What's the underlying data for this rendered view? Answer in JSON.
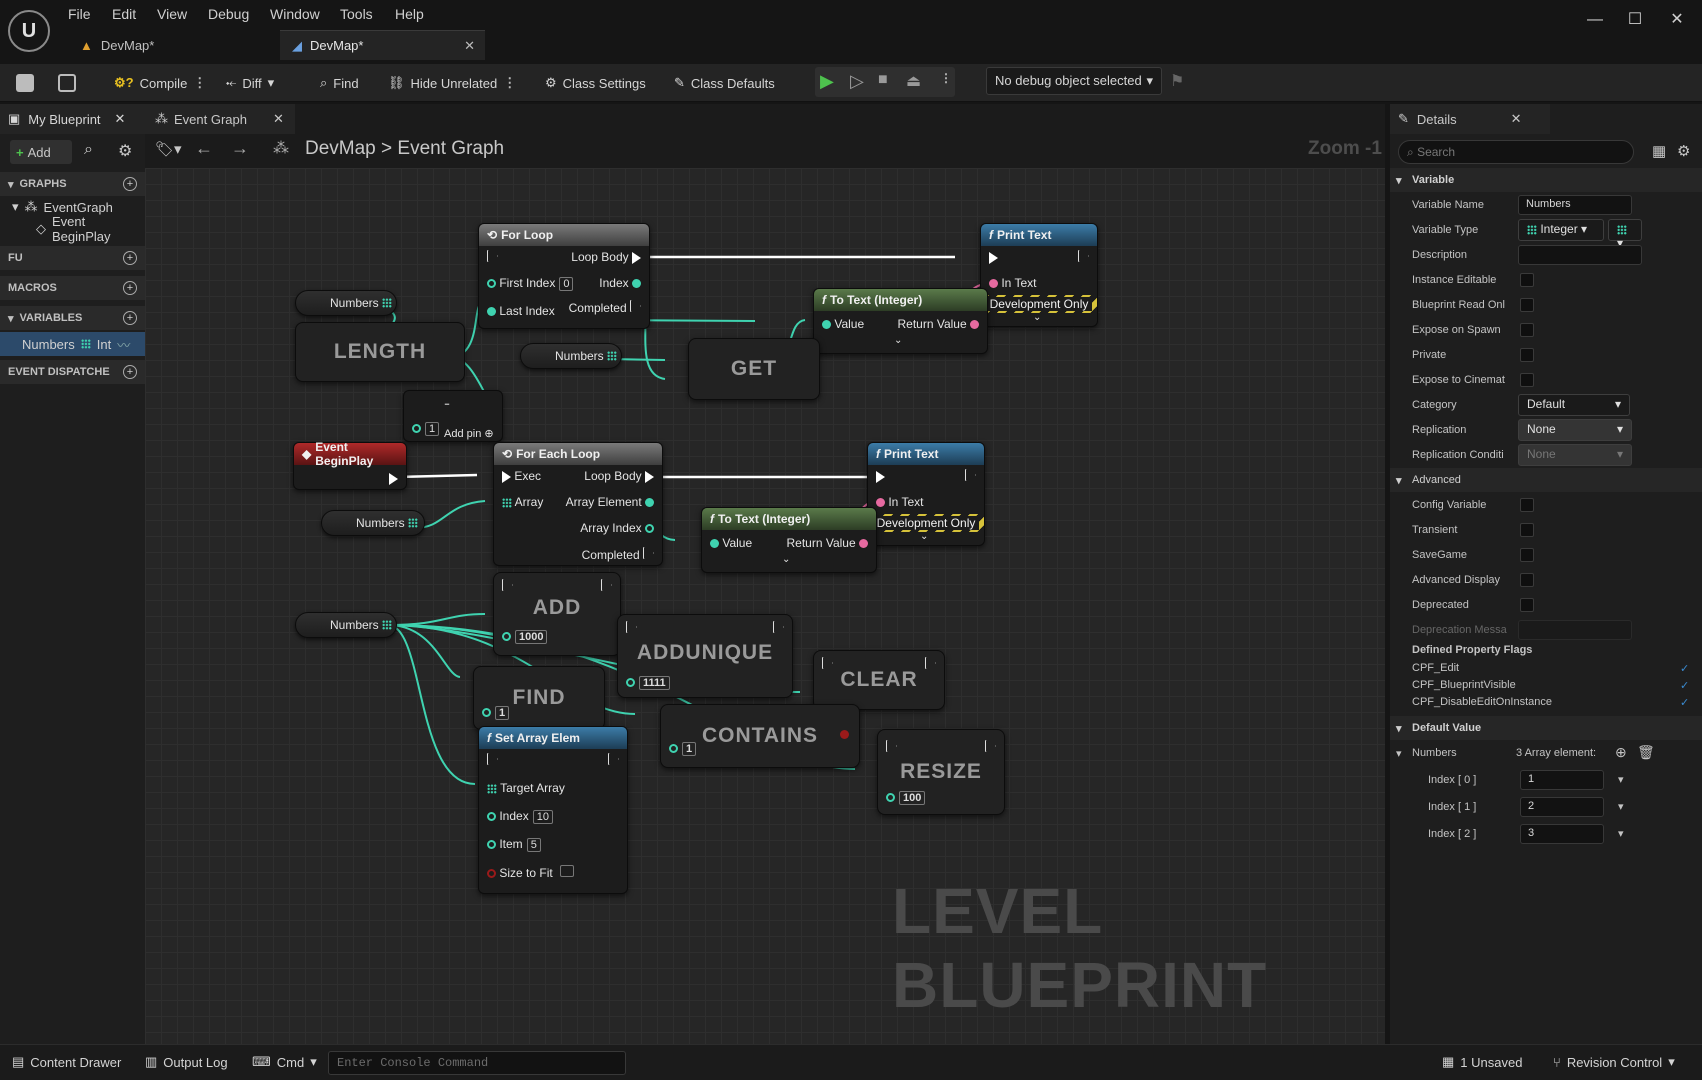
{
  "menu": [
    "File",
    "Edit",
    "View",
    "Debug",
    "Window",
    "Tools",
    "Help"
  ],
  "tabs": [
    {
      "label": "DevMap*"
    },
    {
      "label": "DevMap*"
    }
  ],
  "toolbar": {
    "compile": "Compile",
    "diff": "Diff",
    "find": "Find",
    "hide_unrelated": "Hide Unrelated",
    "class_settings": "Class Settings",
    "class_defaults": "Class Defaults",
    "debug_object": "No debug object selected"
  },
  "left_panel": {
    "tab_my_blueprint": "My Blueprint",
    "tab_event_graph": "Event Graph",
    "add": "Add",
    "graphs": "GRAPHS",
    "eventgraph": "EventGraph",
    "event_begin_play": "Event BeginPlay",
    "functions": "FU",
    "macros": "MACROS",
    "variables": "VARIABLES",
    "var_name": "Numbers",
    "var_type": "Int",
    "event_dispatchers": "EVENT DISPATCHE"
  },
  "graph": {
    "breadcrumb_root": "DevMap",
    "breadcrumb_sep": ">",
    "breadcrumb_leaf": "Event Graph",
    "zoom": "Zoom -1",
    "watermark": "LEVEL BLUEPRINT",
    "for_loop": {
      "title": "For Loop",
      "loop_body": "Loop Body",
      "first_index": "First Index",
      "first_index_val": "0",
      "index": "Index",
      "last_index": "Last Index",
      "completed": "Completed"
    },
    "print_text_1": {
      "title": "Print Text",
      "in_text": "In Text",
      "dev_only": "Development Only"
    },
    "to_text_1": {
      "title": "To Text (Integer)",
      "value": "Value",
      "return_value": "Return Value"
    },
    "numbers_label": "Numbers",
    "length": "LENGTH",
    "get": "GET",
    "minus": "-",
    "minus_val": "1",
    "add_pin": "Add pin",
    "event_begin_play": "Event BeginPlay",
    "for_each": {
      "title": "For Each Loop",
      "exec": "Exec",
      "loop_body": "Loop Body",
      "array": "Array",
      "array_element": "Array Element",
      "array_index": "Array Index",
      "completed": "Completed"
    },
    "print_text_2": {
      "title": "Print Text",
      "in_text": "In Text",
      "dev_only": "Development Only"
    },
    "to_text_2": {
      "title": "To Text (Integer)",
      "value": "Value",
      "return_value": "Return Value"
    },
    "add": "ADD",
    "add_val": "1000",
    "addunique": "ADDUNIQUE",
    "addunique_val": "1111",
    "clear": "CLEAR",
    "find": "FIND",
    "find_val": "1",
    "contains": "CONTAINS",
    "contains_val": "1",
    "resize": "RESIZE",
    "resize_val": "100",
    "set_array_elem": {
      "title": "Set Array Elem",
      "target_array": "Target Array",
      "index": "Index",
      "index_val": "10",
      "item": "Item",
      "item_val": "5",
      "size_to_fit": "Size to Fit"
    }
  },
  "details": {
    "title": "Details",
    "search_placeholder": "Search",
    "sec_variable": "Variable",
    "variable_name_label": "Variable Name",
    "variable_name": "Numbers",
    "variable_type_label": "Variable Type",
    "variable_type": "Integer",
    "description_label": "Description",
    "instance_editable": "Instance Editable",
    "blueprint_read_only": "Blueprint Read Onl",
    "expose_on_spawn": "Expose on Spawn",
    "private": "Private",
    "expose_to_cinematics": "Expose to Cinemat",
    "category_label": "Category",
    "category": "Default",
    "replication_label": "Replication",
    "replication": "None",
    "replication_condition_label": "Replication Conditi",
    "replication_condition": "None",
    "sec_advanced": "Advanced",
    "config_variable": "Config Variable",
    "transient": "Transient",
    "savegame": "SaveGame",
    "advanced_display": "Advanced Display",
    "deprecated": "Deprecated",
    "deprecation_message": "Deprecation Messa",
    "defined_flags": "Defined Property Flags",
    "flags": [
      "CPF_Edit",
      "CPF_BlueprintVisible",
      "CPF_DisableEditOnInstance"
    ],
    "sec_default_value": "Default Value",
    "numbers_label": "Numbers",
    "array_count": "3 Array element:",
    "elements": [
      {
        "label": "Index [ 0 ]",
        "value": "1"
      },
      {
        "label": "Index [ 1 ]",
        "value": "2"
      },
      {
        "label": "Index [ 2 ]",
        "value": "3"
      }
    ]
  },
  "status": {
    "content_drawer": "Content Drawer",
    "output_log": "Output Log",
    "cmd": "Cmd",
    "console_placeholder": "Enter Console Command",
    "unsaved": "1 Unsaved",
    "revision_control": "Revision Control"
  },
  "colors": {
    "exec": "#ffffff",
    "int_pin": "#3fd3b0",
    "text_pin": "#e66aa0",
    "bool_pin": "#9a1a1a",
    "accent_blue": "#3c7ca8",
    "selected_var": "#2c4a6a"
  }
}
